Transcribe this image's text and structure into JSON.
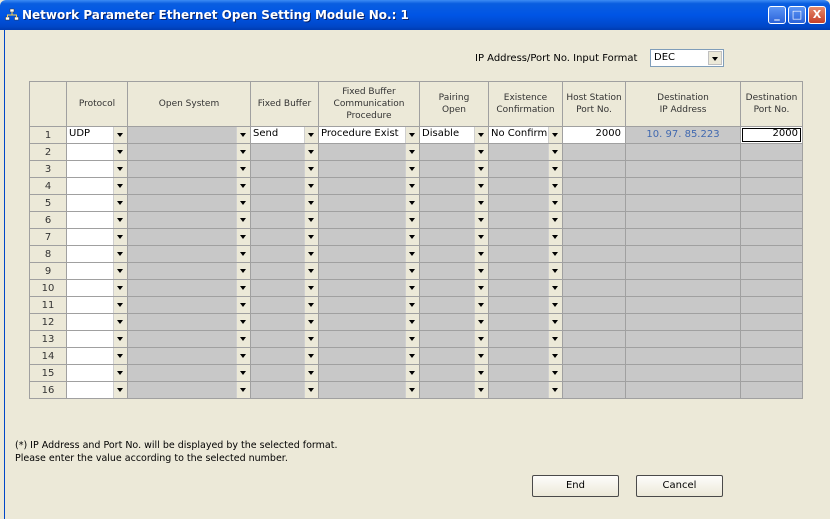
{
  "window": {
    "title": "Network Parameter  Ethernet Open Setting Module No.: 1",
    "min_glyph": "_",
    "max_glyph": "□",
    "close_glyph": "X",
    "icon": "network-icon"
  },
  "format": {
    "label": "IP Address/Port No. Input Format",
    "value": "DEC"
  },
  "table": {
    "headers": {
      "protocol": "Protocol",
      "open_system": "Open System",
      "fixed_buffer": "Fixed Buffer",
      "fbcp_1": "Fixed Buffer",
      "fbcp_2": "Communication",
      "fbcp_3": "Procedure",
      "pairing_1": "Pairing",
      "pairing_2": "Open",
      "existence_1": "Existence",
      "existence_2": "Confirmation",
      "host_1": "Host Station",
      "host_2": "Port No.",
      "dest_ip_1": "Destination",
      "dest_ip_2": "IP Address",
      "dest_port_1": "Destination",
      "dest_port_2": "Port No."
    },
    "rows": [
      {
        "no": "1",
        "protocol": "UDP",
        "open_system": "",
        "fixed_buffer": "Send",
        "procedure": "Procedure Exist",
        "pairing": "Disable",
        "existence": "No Confirm",
        "host_port": "2000",
        "dest_ip": "10. 97. 85.223",
        "dest_port": "2000"
      },
      {
        "no": "2"
      },
      {
        "no": "3"
      },
      {
        "no": "4"
      },
      {
        "no": "5"
      },
      {
        "no": "6"
      },
      {
        "no": "7"
      },
      {
        "no": "8"
      },
      {
        "no": "9"
      },
      {
        "no": "10"
      },
      {
        "no": "11"
      },
      {
        "no": "12"
      },
      {
        "no": "13"
      },
      {
        "no": "14"
      },
      {
        "no": "15"
      },
      {
        "no": "16"
      }
    ]
  },
  "notes": {
    "line1": "(*) IP Address and Port No. will be displayed by the selected format.",
    "line2": "Please enter the value according to the selected number."
  },
  "buttons": {
    "end": "End",
    "cancel": "Cancel"
  }
}
